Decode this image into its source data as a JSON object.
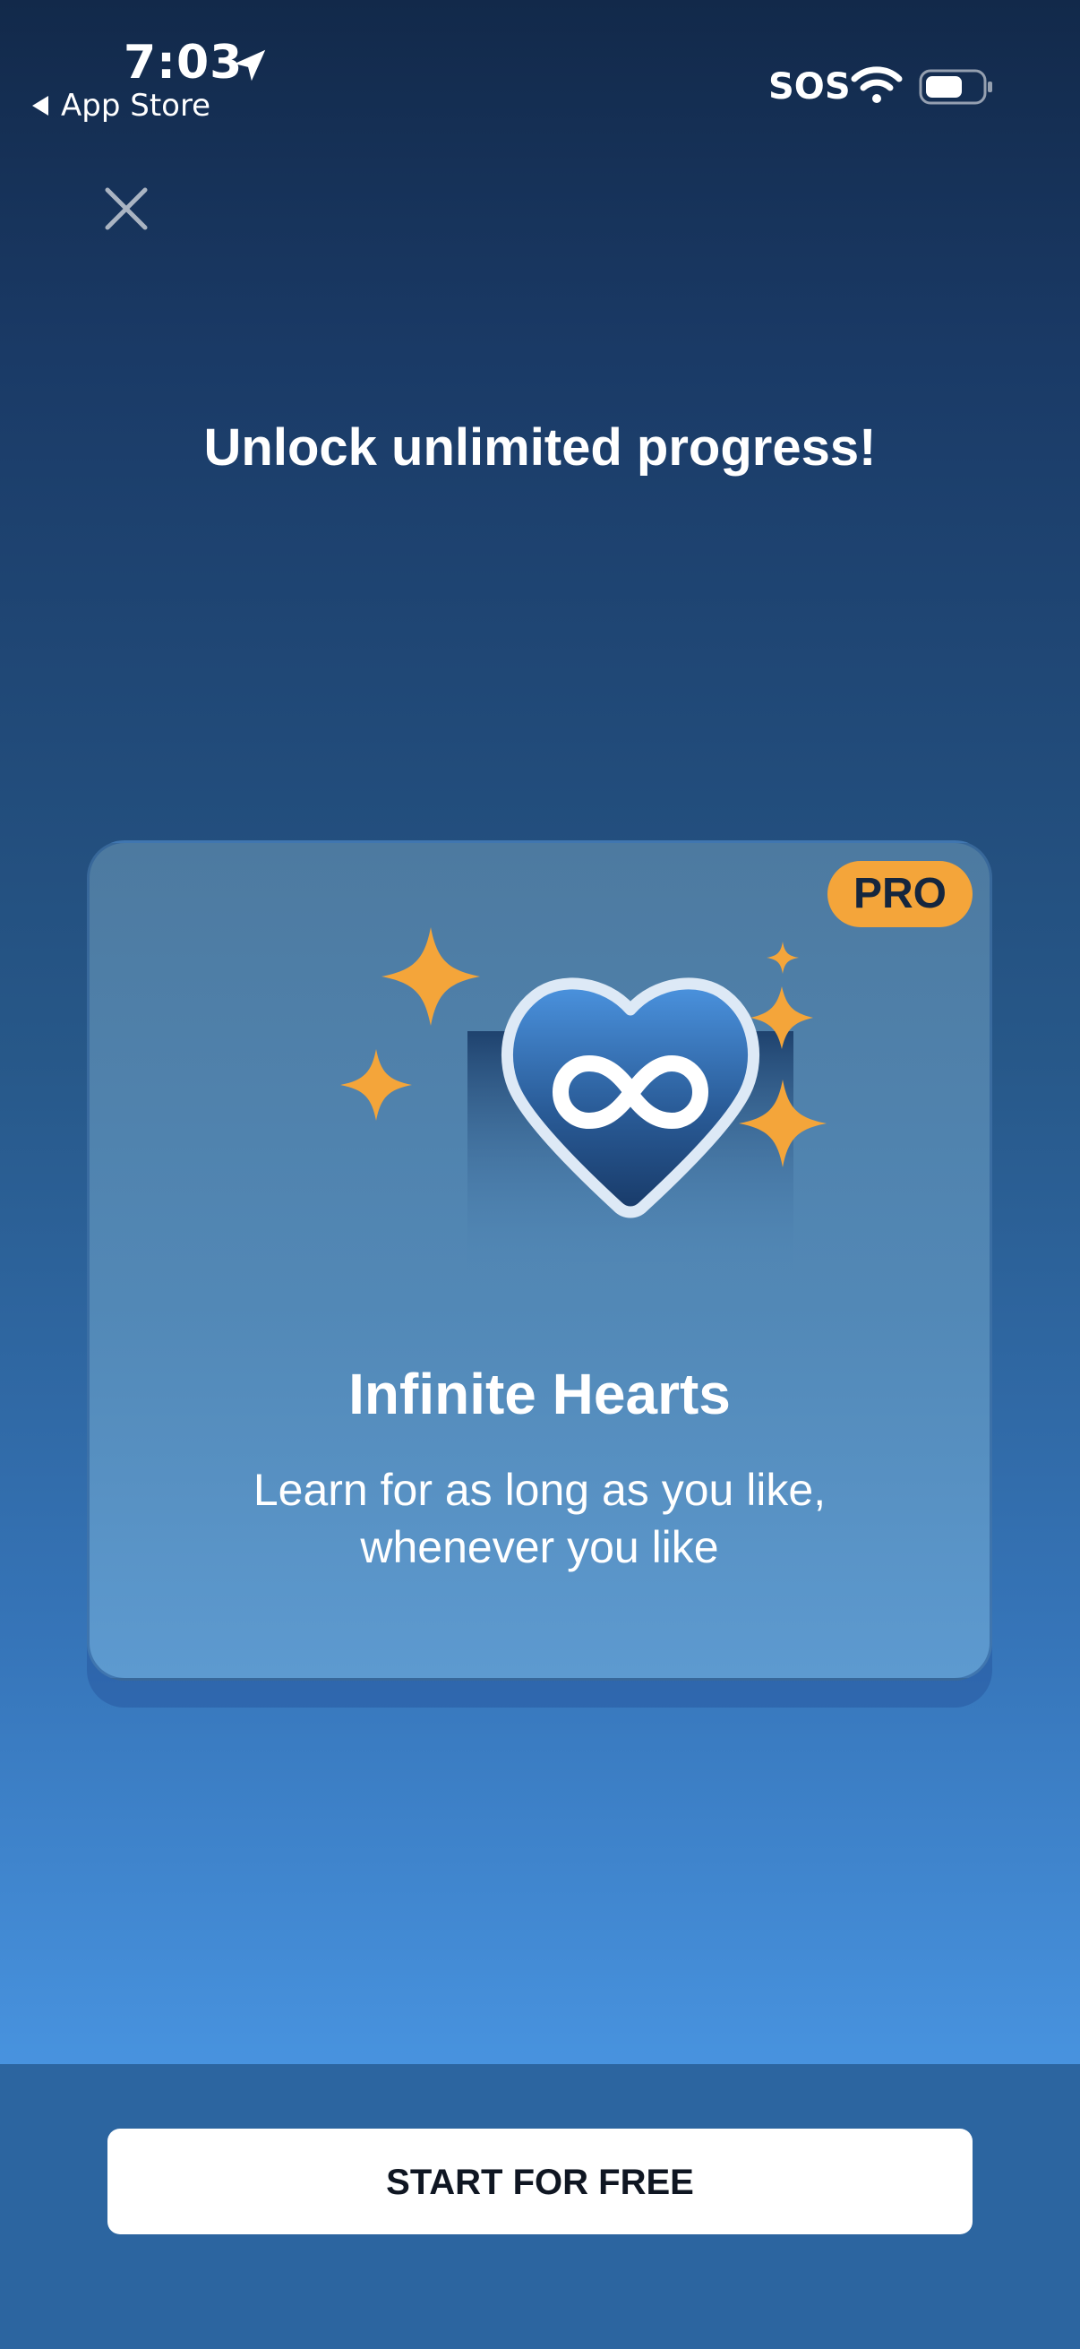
{
  "status_bar": {
    "time": "7:03",
    "back_label": "App Store",
    "sos": "SOS"
  },
  "headline": "Unlock unlimited progress!",
  "feature": {
    "badge": "PRO",
    "title": "Infinite Hearts",
    "description": "Learn for as long as you like, whenever you like"
  },
  "cta": {
    "label": "START FOR FREE"
  },
  "colors": {
    "accent": "#f4a53a",
    "background_top": "#12294a",
    "background_bottom": "#4a95e2",
    "bottom_bar": "#2c65a0"
  },
  "icons": [
    "location-arrow-icon",
    "back-triangle-icon",
    "wifi-icon",
    "battery-icon",
    "close-icon",
    "heart-icon",
    "infinity-icon",
    "sparkle-icon"
  ]
}
